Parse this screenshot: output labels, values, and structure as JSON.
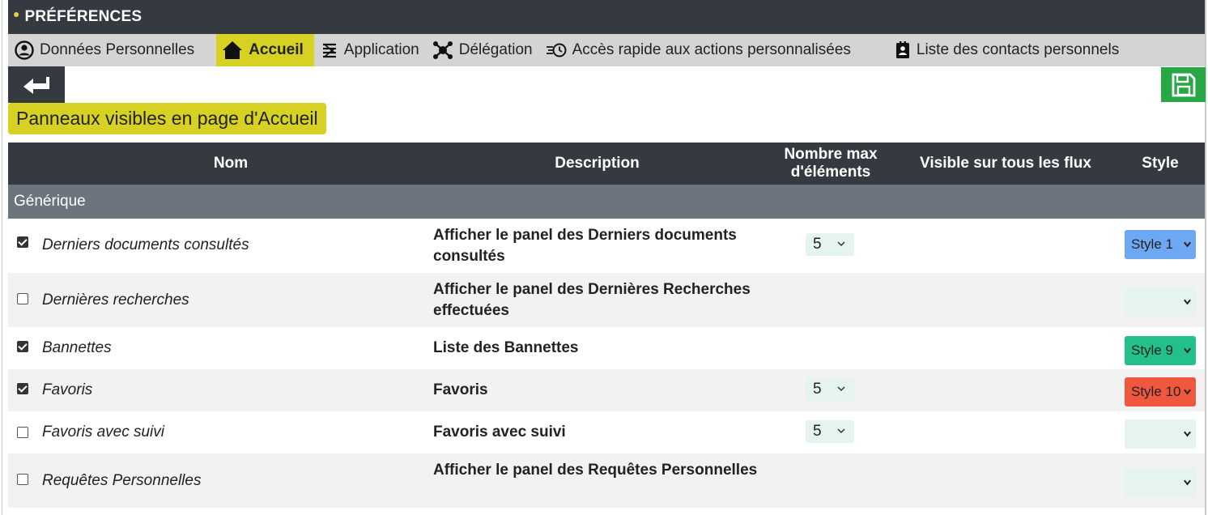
{
  "header": {
    "title": "PRÉFÉRENCES"
  },
  "tabs": [
    {
      "label": "Données Personnelles",
      "icon": "user-circle-icon"
    },
    {
      "label": "Accueil",
      "icon": "home-icon",
      "active": true
    },
    {
      "label": "Application",
      "icon": "application-icon"
    },
    {
      "label": "Délégation",
      "icon": "delegation-icon"
    },
    {
      "label": "Accès rapide aux actions personnalisées",
      "icon": "quick-actions-icon"
    },
    {
      "label": "Liste des contacts personnels",
      "icon": "contact-book-icon"
    }
  ],
  "toolbar": {
    "back_icon": "back-arrow-icon",
    "save_icon": "floppy-disk-icon"
  },
  "section": {
    "title": "Panneaux visibles en page d'Accueil"
  },
  "table": {
    "columns": {
      "name": "Nom",
      "description": "Description",
      "max_items": "Nombre max d'éléments",
      "visible_all_flows": "Visible sur tous les flux",
      "style": "Style"
    },
    "group": "Générique",
    "rows": [
      {
        "checked": true,
        "name": "Derniers documents consultés",
        "description": "Afficher le panel des Derniers documents consultés",
        "max": "5",
        "style": "Style 1",
        "style_color": "#6ea8f2"
      },
      {
        "checked": false,
        "name": "Dernières recherches",
        "description": "Afficher le panel des Dernières Recherches effectuées",
        "max": "",
        "style": "",
        "style_color": "#e6f4ee"
      },
      {
        "checked": true,
        "name": "Bannettes",
        "description": "Liste des Bannettes",
        "max": "",
        "style": "Style 9",
        "style_color": "#23c08a"
      },
      {
        "checked": true,
        "name": "Favoris",
        "description": "Favoris",
        "max": "5",
        "style": "Style 10",
        "style_color": "#f0573f"
      },
      {
        "checked": false,
        "name": "Favoris avec suivi",
        "description": "Favoris avec suivi",
        "max": "5",
        "style": "",
        "style_color": "#e6f4ee"
      },
      {
        "checked": false,
        "name": "Requêtes Personnelles",
        "description": "Afficher le panel des Requêtes Personnelles",
        "max": "",
        "style": "",
        "style_color": "#e6f4ee"
      }
    ]
  }
}
